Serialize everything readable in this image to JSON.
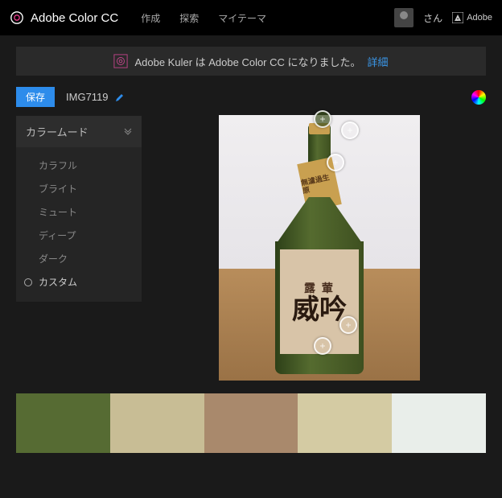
{
  "header": {
    "app_name": "Adobe Color CC",
    "nav": {
      "create": "作成",
      "explore": "探索",
      "mythemes": "マイテーマ"
    },
    "user_suffix": "さん",
    "brand": "Adobe"
  },
  "banner": {
    "text": "Adobe Kuler は Adobe Color CC になりました。",
    "link": "詳細"
  },
  "toolbar": {
    "save_label": "保存",
    "image_title": "IMG7119"
  },
  "sidebar": {
    "panel_title": "カラームード",
    "moods": {
      "colorful": "カラフル",
      "bright": "ブライト",
      "mute": "ミュート",
      "deep": "ディープ",
      "dark": "ダーク",
      "custom": "カスタム"
    }
  },
  "image_subject": {
    "neck_label": "無濾過生原",
    "main_label_top": "露 葷",
    "main_label_big": "威吟"
  },
  "palette": {
    "c1": "#566b33",
    "c2": "#c8bd95",
    "c3": "#a9896c",
    "c4": "#d4cba3",
    "c5": "#e9eeea"
  }
}
